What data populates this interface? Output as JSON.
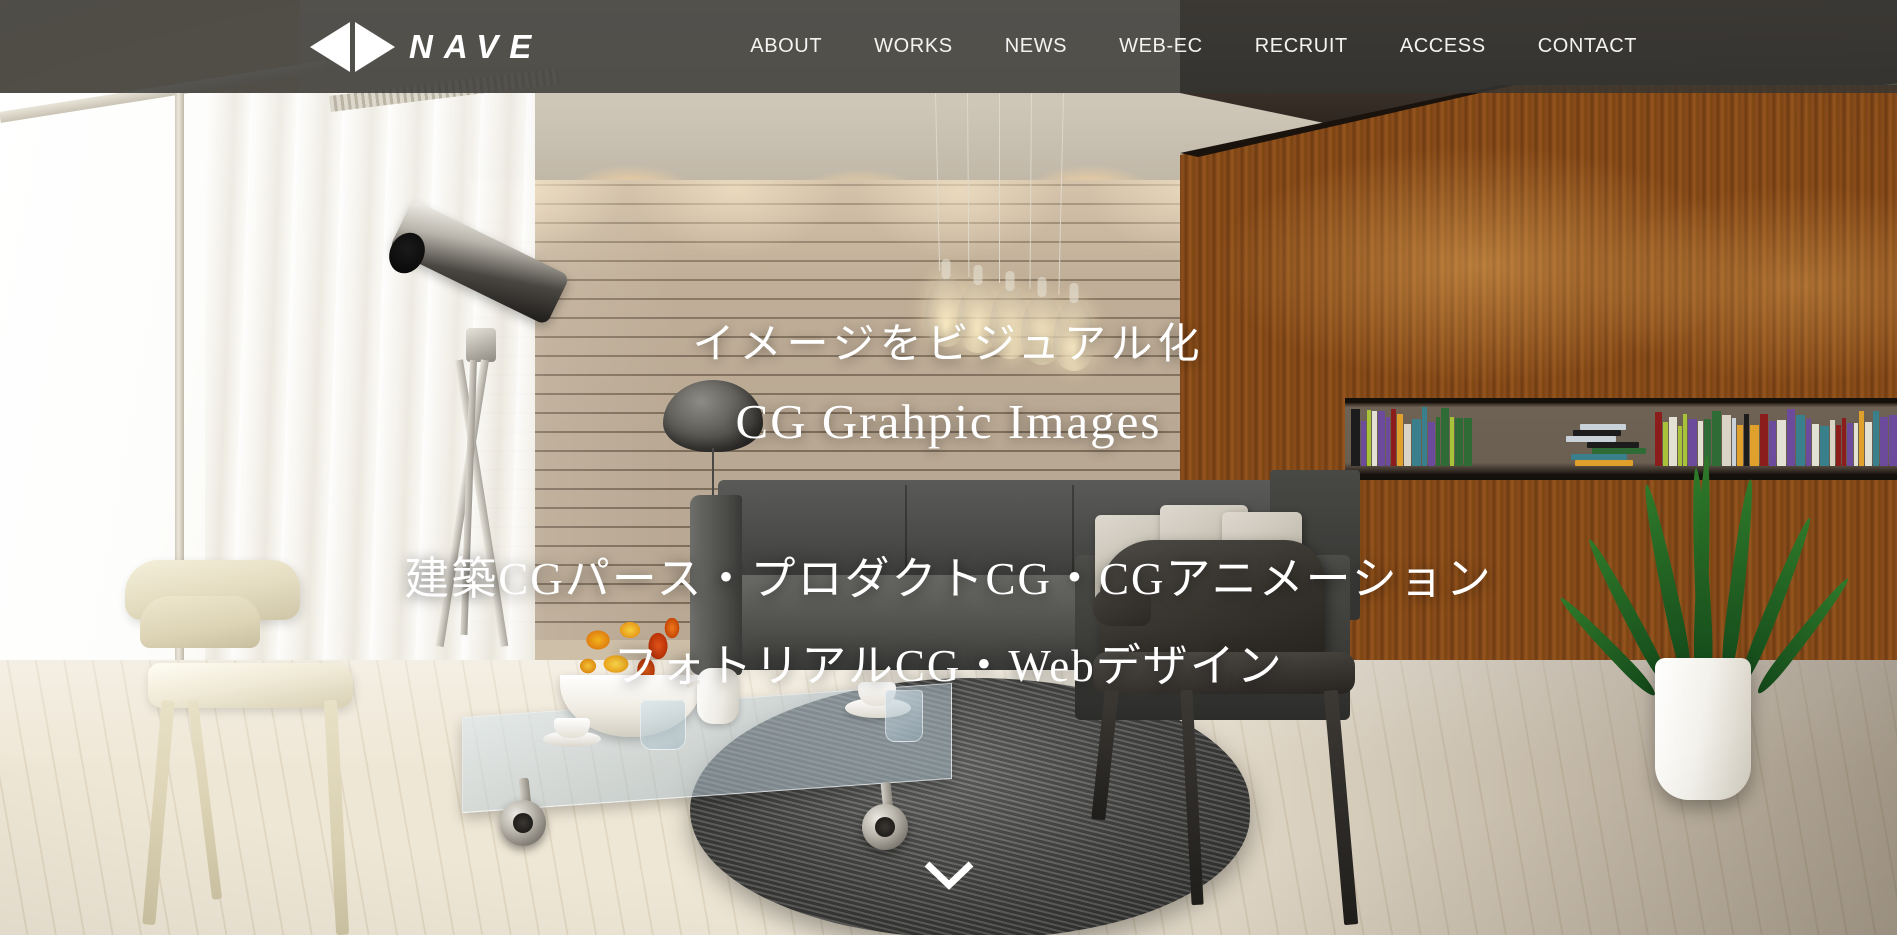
{
  "site": {
    "brand": "NAVE",
    "logo_mark": "double-triangle"
  },
  "header": {
    "nav": [
      {
        "label": "ABOUT",
        "name": "nav-item-about"
      },
      {
        "label": "WORKS",
        "name": "nav-item-works"
      },
      {
        "label": "NEWS",
        "name": "nav-item-news"
      },
      {
        "label": "WEB-EC",
        "name": "nav-item-web-ec"
      },
      {
        "label": "RECRUIT",
        "name": "nav-item-recruit"
      },
      {
        "label": "ACCESS",
        "name": "nav-item-access"
      },
      {
        "label": "CONTACT",
        "name": "nav-item-contact"
      }
    ],
    "background_color": "#343432",
    "text_color": "#f3f3f2"
  },
  "hero": {
    "headline_jp": "イメージをビジュアル化",
    "headline_en": "CG Grahpic Images",
    "services_line_1": "建築CGパース・プロダクトCG・CGアニメーション",
    "services_line_2": "フォトリアルCG・Webデザイン",
    "text_color": "#ffffff",
    "scroll_icon": "chevron-down-icon",
    "background_description": "interior-living-room-cg-render"
  }
}
